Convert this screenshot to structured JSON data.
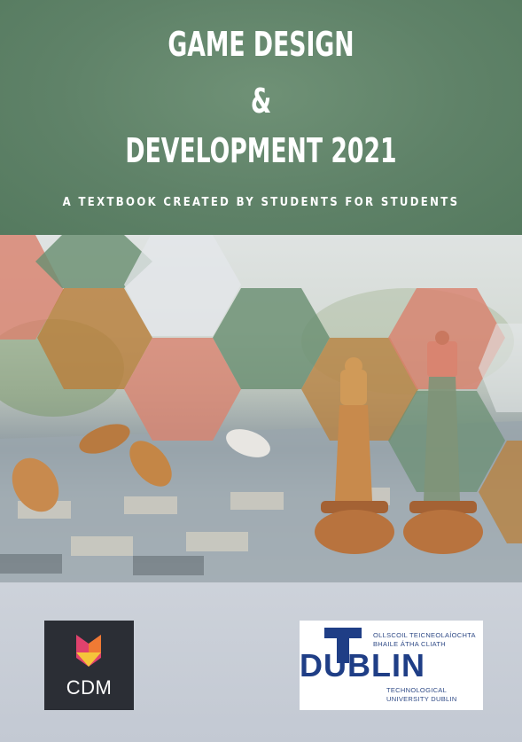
{
  "title": {
    "line1": "GAME DESIGN",
    "line2": "&",
    "line3": "DEVELOPMENT 2021"
  },
  "subtitle": "A TEXTBOOK CREATED BY STUDENTS FOR STUDENTS",
  "logos": {
    "cdm": {
      "text": "CDM"
    },
    "tud": {
      "irish_line1": "OLLSCOIL TEICNEOLAÍOCHTA",
      "irish_line2": "BHAILE ÁTHA CLIATH",
      "wordmark": "DUBLIN",
      "english_line1": "TECHNOLOGICAL",
      "english_line2": "UNIVERSITY DUBLIN"
    }
  },
  "colors": {
    "header_green": "#5f8268",
    "hex_coral": "#d9836f",
    "hex_ochre": "#b9813f",
    "hex_sage": "#6a8f72",
    "cdm_bg": "#2b2e35",
    "tud_blue": "#1f3e86"
  }
}
